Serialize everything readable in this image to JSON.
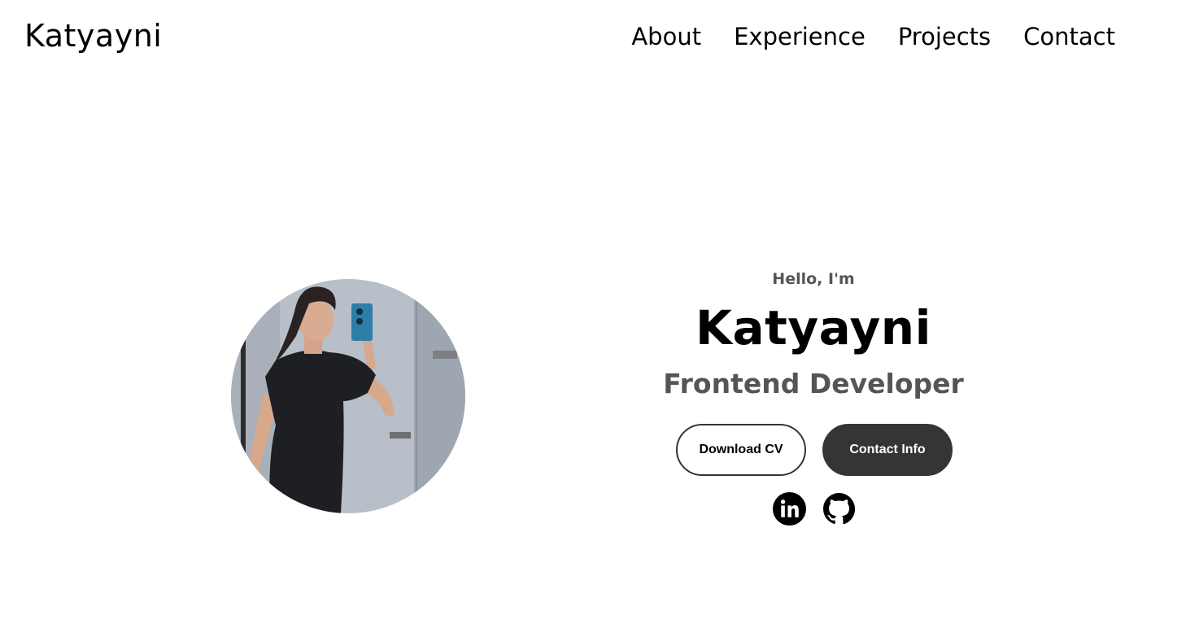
{
  "nav": {
    "logo": "Katyayni",
    "links": [
      {
        "label": "About"
      },
      {
        "label": "Experience"
      },
      {
        "label": "Projects"
      },
      {
        "label": "Contact"
      }
    ]
  },
  "hero": {
    "greeting": "Hello, I'm",
    "name": "Katyayni",
    "role": "Frontend Developer",
    "buttons": {
      "download_cv": "Download CV",
      "contact_info": "Contact Info"
    },
    "profile_image_alt": "profile photo",
    "socials": [
      {
        "icon": "linkedin-icon"
      },
      {
        "icon": "github-icon"
      }
    ]
  },
  "colors": {
    "dark_button": "#353535",
    "muted_text": "#555555"
  }
}
